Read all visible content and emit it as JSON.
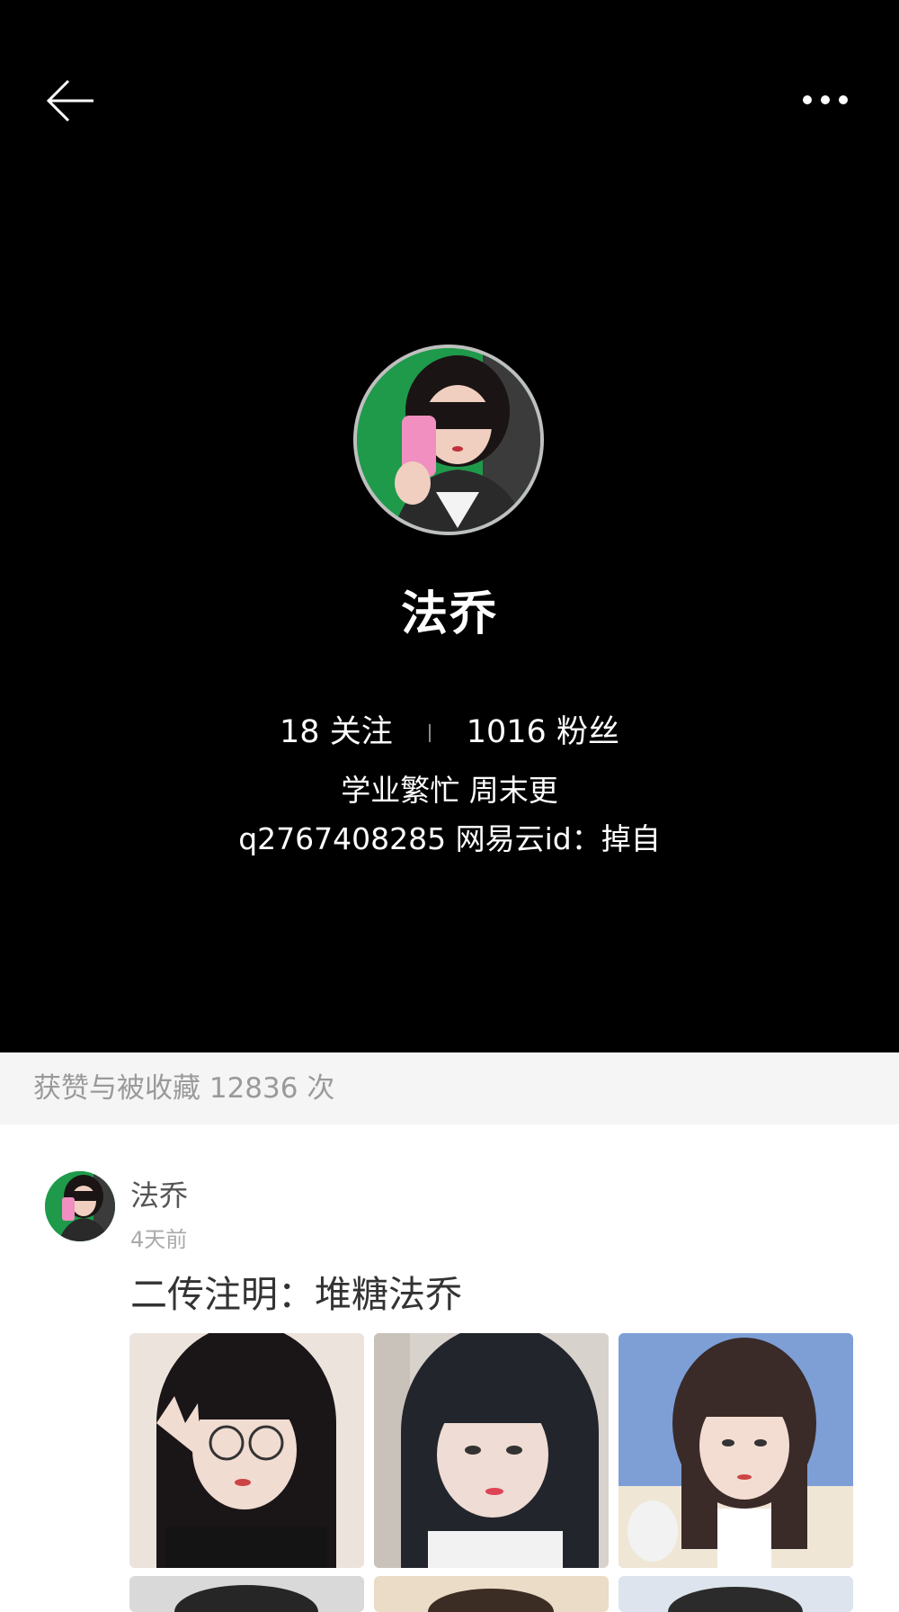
{
  "nav": {
    "back_icon": "back-arrow-icon",
    "more_icon": "more-dots-icon"
  },
  "profile": {
    "name": "法乔",
    "following_count": "18",
    "following_label": "关注",
    "followers_count": "1016",
    "followers_label": "粉丝",
    "bio_line1": "学业繁忙 周末更",
    "bio_line2": "q2767408285 网易云id：掉自"
  },
  "likes_bar": {
    "text": "获赞与被收藏 12836 次"
  },
  "post": {
    "author": "法乔",
    "time": "4天前",
    "text": "二传注明：堆糖法乔",
    "images": [
      "photo-1",
      "photo-2",
      "photo-3",
      "photo-4",
      "photo-5",
      "photo-6"
    ]
  },
  "colors": {
    "header_bg": "#000000",
    "likes_bar_bg": "#f5f5f5",
    "avatar_green": "#1e9a4a"
  }
}
